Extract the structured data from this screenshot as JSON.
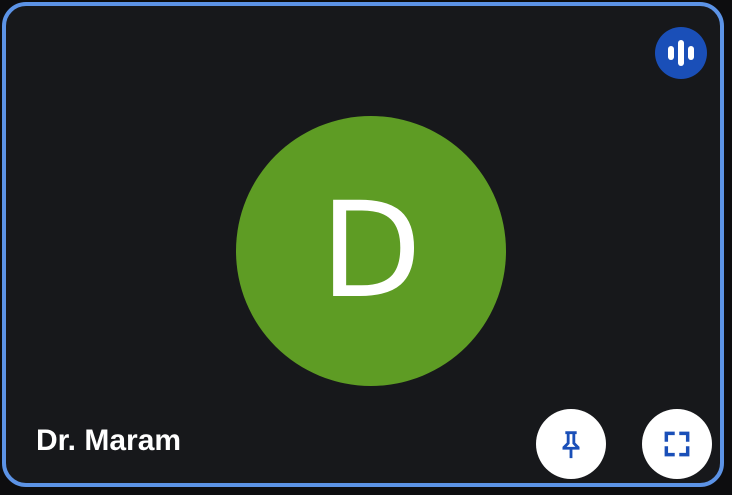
{
  "participant": {
    "name": "Dr. Maram",
    "initial": "D",
    "avatar_color": "#5e9c24",
    "speaking": true
  },
  "tile": {
    "border_color": "#5c93e6",
    "background_color": "#17181b"
  },
  "icons": {
    "speaking_indicator": "audio-level-icon",
    "pin": "pin-icon",
    "fullscreen": "fullscreen-icon"
  },
  "accent_color": "#1a4fb8"
}
